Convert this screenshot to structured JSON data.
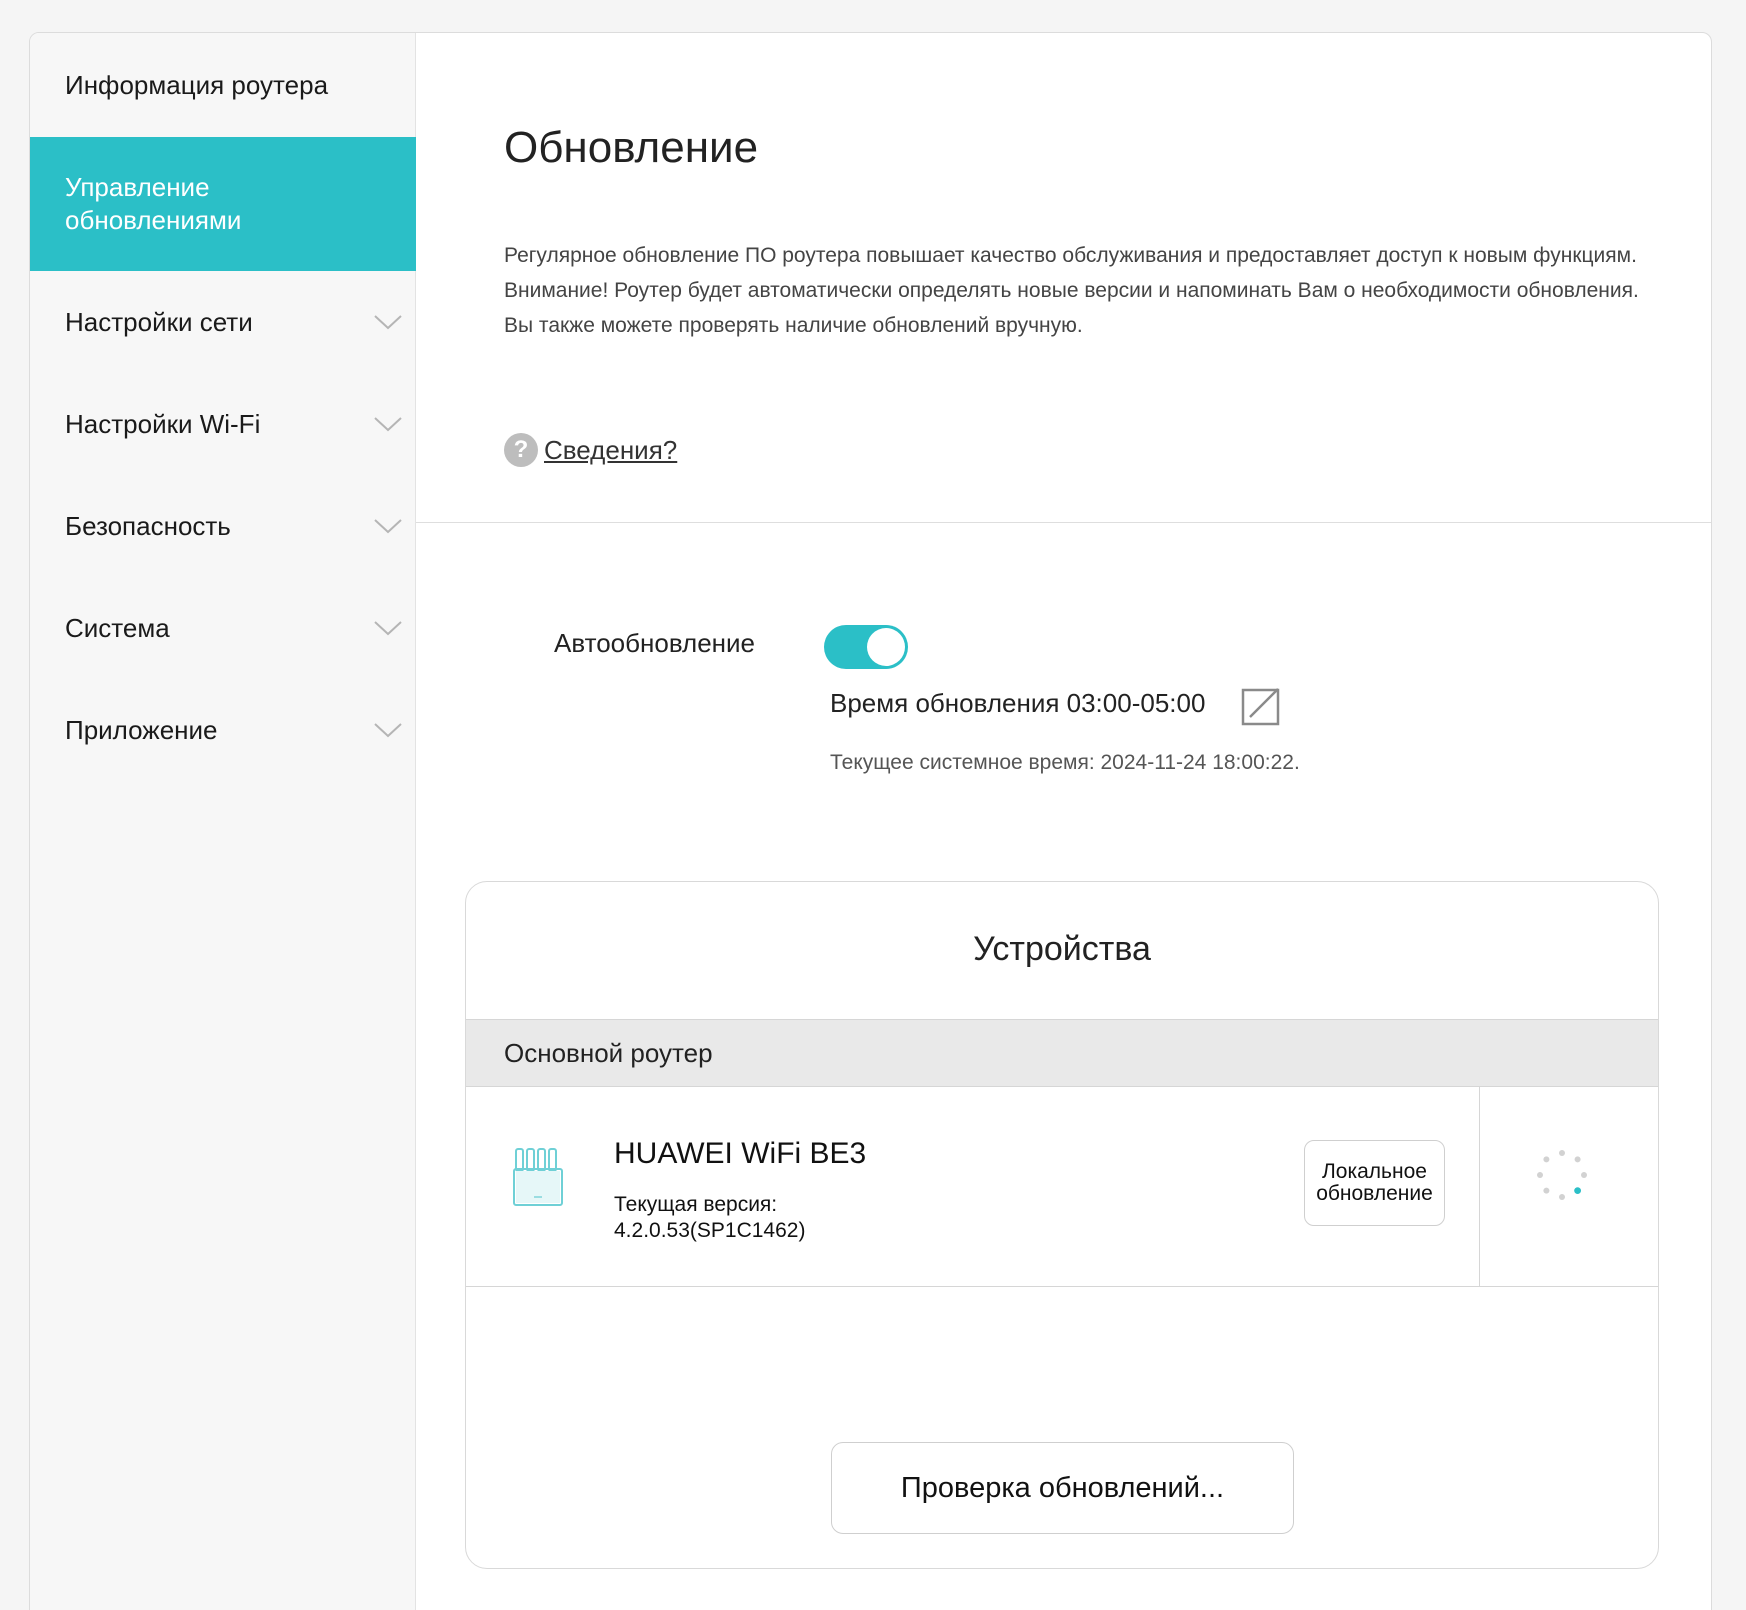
{
  "sidebar": {
    "items": [
      {
        "label": "Информация роутера",
        "active": false,
        "expandable": false
      },
      {
        "label": "Управление обновлениями",
        "active": true,
        "expandable": false
      },
      {
        "label": "Настройки сети",
        "active": false,
        "expandable": true
      },
      {
        "label": "Настройки Wi-Fi",
        "active": false,
        "expandable": true
      },
      {
        "label": "Безопасность",
        "active": false,
        "expandable": true
      },
      {
        "label": "Система",
        "active": false,
        "expandable": true
      },
      {
        "label": "Приложение",
        "active": false,
        "expandable": true
      }
    ]
  },
  "header": {
    "title": "Обновление",
    "description_line1": "Регулярное обновление ПО роутера повышает качество обслуживания и предоставляет доступ к новым функциям.",
    "description_line2": "Внимание! Роутер будет автоматически определять новые версии и напоминать Вам о необходимости обновления. Вы также можете проверять наличие обновлений вручную.",
    "help_link": "Сведения?",
    "help_icon": "question-circle-icon"
  },
  "auto_update": {
    "label": "Автообновление",
    "enabled": true,
    "update_time": "Время обновления 03:00-05:00",
    "system_time": "Текущее системное время: 2024-11-24 18:00:22."
  },
  "devices": {
    "title": "Устройства",
    "section": "Основной роутер",
    "device": {
      "name": "HUAWEI WiFi BE3",
      "version_label": "Текущая версия:",
      "version_value": "4.2.0.53(SP1C1462)",
      "local_update_label": "Локальное обновление",
      "icon": "router-icon",
      "status_icon": "loading-spinner-icon"
    },
    "check_button": "Проверка обновлений..."
  },
  "colors": {
    "accent": "#2bbfc7",
    "sidebar_bg": "#f7f7f7",
    "page_bg": "#f5f5f5"
  }
}
